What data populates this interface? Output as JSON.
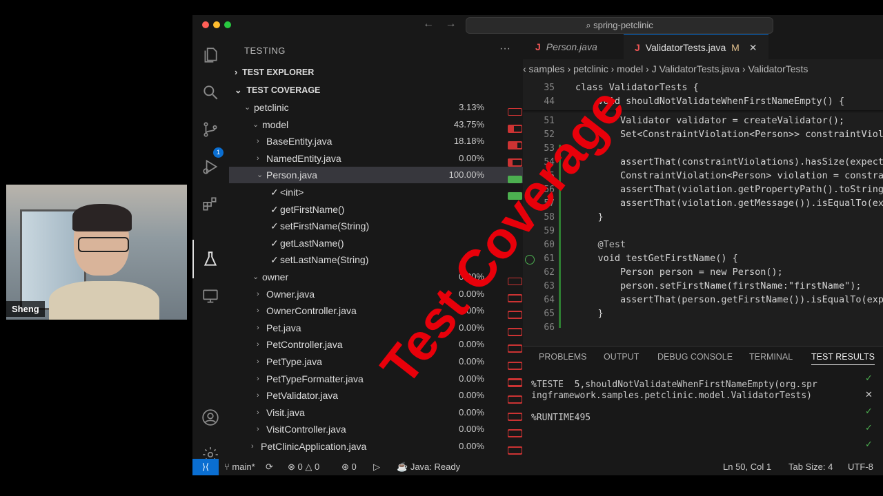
{
  "webcam": {
    "name": "Sheng"
  },
  "titlebar": {
    "search": "spring-petclinic",
    "back": "←",
    "forward": "→"
  },
  "sidebar": {
    "title": "TESTING",
    "more": "···",
    "sections": {
      "explorer": "TEST EXPLORER",
      "coverage": "TEST COVERAGE"
    },
    "rows": [
      {
        "label": "petclinic",
        "pct": "3.13%",
        "fill": 0.0313
      },
      {
        "label": "model",
        "pct": "43.75%",
        "fill": 0.4375
      },
      {
        "label": "BaseEntity.java",
        "pct": "18.18%",
        "fill": 0.1818
      },
      {
        "label": "NamedEntity.java",
        "pct": "0.00%",
        "fill": 0
      },
      {
        "label": "Person.java",
        "pct": "100.00%",
        "fill": 1
      },
      {
        "label": "<init>"
      },
      {
        "label": "getFirstName()"
      },
      {
        "label": "setFirstName(String)"
      },
      {
        "label": "getLastName()"
      },
      {
        "label": "setLastName(String)"
      },
      {
        "label": "owner",
        "pct": "0.00%",
        "fill": 0
      },
      {
        "label": "Owner.java",
        "pct": "0.00%",
        "fill": 0
      },
      {
        "label": "OwnerController.java",
        "pct": "0.00%",
        "fill": 0
      },
      {
        "label": "Pet.java",
        "pct": "0.00%",
        "fill": 0
      },
      {
        "label": "PetController.java",
        "pct": "0.00%",
        "fill": 0
      },
      {
        "label": "PetType.java",
        "pct": "0.00%",
        "fill": 0
      },
      {
        "label": "PetTypeFormatter.java",
        "pct": "0.00%",
        "fill": 0
      },
      {
        "label": "PetValidator.java",
        "pct": "0.00%",
        "fill": 0
      },
      {
        "label": "Visit.java",
        "pct": "0.00%",
        "fill": 0
      },
      {
        "label": "VisitController.java",
        "pct": "0.00%",
        "fill": 0
      },
      {
        "label": "PetClinicApplication.java",
        "pct": "0.00%",
        "fill": 0
      }
    ]
  },
  "tabs": [
    {
      "label": "Person.java",
      "icon": "J"
    },
    {
      "label": "ValidatorTests.java",
      "icon": "J",
      "modified": "M",
      "close": "✕"
    }
  ],
  "breadcrumb": "‹ samples › petclinic › model › J ValidatorTests.java › ValidatorTests",
  "editor": {
    "lines": [
      {
        "n": "35",
        "t": "class ValidatorTests {"
      },
      {
        "n": "44",
        "t": "    void shouldNotValidateWhenFirstNameEmpty() {"
      },
      {
        "n": "51",
        "t": "        Validator validator = createValidator();"
      },
      {
        "n": "52",
        "t": "        Set<ConstraintViolation<Person>> constraintViola"
      },
      {
        "n": "53",
        "t": ""
      },
      {
        "n": "54",
        "t": "        assertThat(constraintViolations).hasSize(expecte"
      },
      {
        "n": "55",
        "t": "        ConstraintViolation<Person> violation = constrai"
      },
      {
        "n": "56",
        "t": "        assertThat(violation.getPropertyPath().toString"
      },
      {
        "n": "57",
        "t": "        assertThat(violation.getMessage()).isEqualTo(exp"
      },
      {
        "n": "58",
        "t": "    }"
      },
      {
        "n": "59",
        "t": ""
      },
      {
        "n": "60",
        "t": "    @Test"
      },
      {
        "n": "61",
        "t": "    void testGetFirstName() {"
      },
      {
        "n": "62",
        "t": "        Person person = new Person();"
      },
      {
        "n": "63",
        "t": "        person.setFirstName(firstName:\"firstName\");"
      },
      {
        "n": "64",
        "t": "        assertThat(person.getFirstName()).isEqualTo(expe"
      },
      {
        "n": "65",
        "t": "    }"
      },
      {
        "n": "66",
        "t": ""
      }
    ]
  },
  "panel": {
    "tabs": [
      "PROBLEMS",
      "OUTPUT",
      "DEBUG CONSOLE",
      "TERMINAL",
      "TEST RESULTS"
    ],
    "output": [
      "%TESTE  5,shouldNotValidateWhenFirstNameEmpty(org.spr",
      "ingframework.samples.petclinic.model.ValidatorTests)",
      "%RUNTIME495"
    ]
  },
  "status": {
    "branch": "main*",
    "errors": "0",
    "warnings": "0",
    "ports": "0",
    "java": "Java: Ready",
    "position": "Ln 50, Col 1",
    "tabsize": "Tab Size: 4",
    "encoding": "UTF-8"
  },
  "watermark": "Test Coverage",
  "colors": {
    "accent": "#0a6ed1",
    "covered": "#4caf50",
    "uncovered": "#cc3333",
    "watermark": "#e8000a"
  }
}
